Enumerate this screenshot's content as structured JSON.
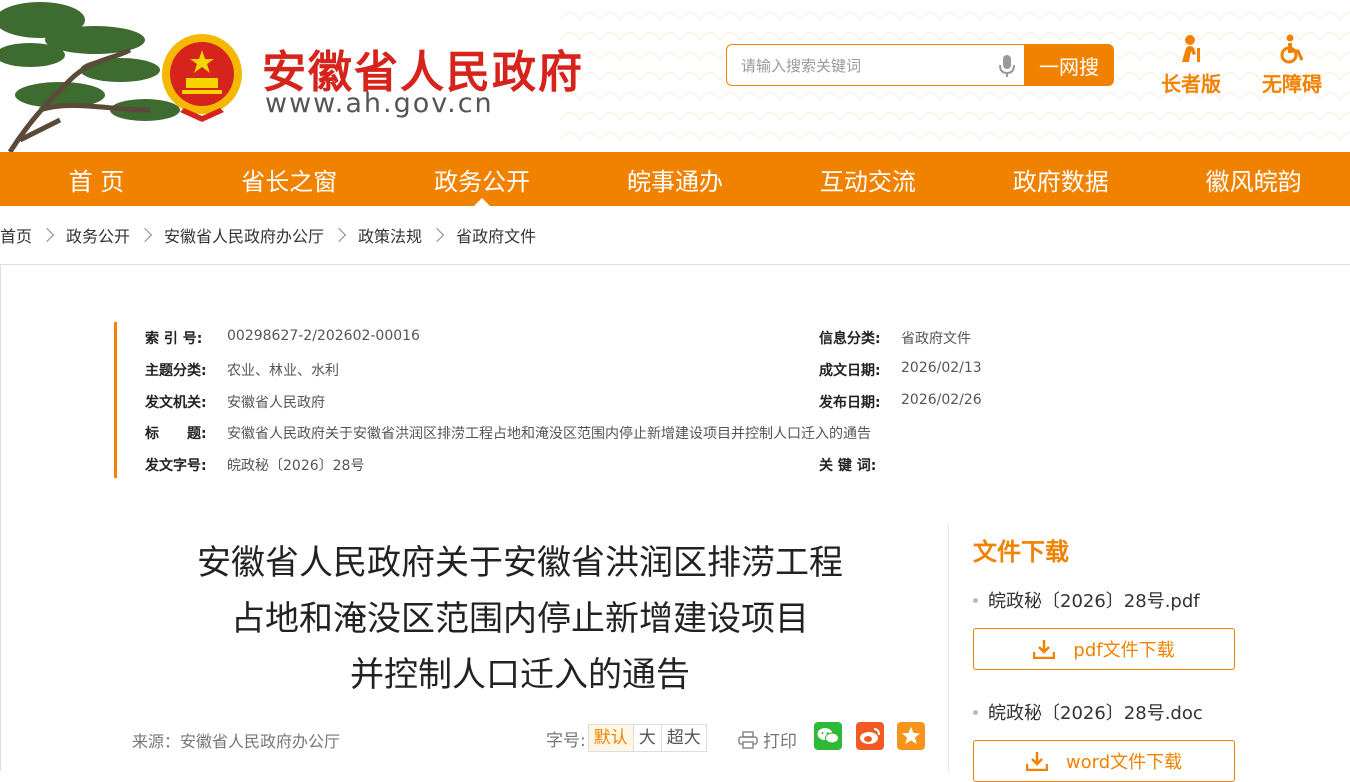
{
  "header": {
    "site_name": "安徽省人民政府",
    "site_url": "www.ah.gov.cn",
    "search": {
      "placeholder": "请输入搜索关键词",
      "button": "一网搜"
    },
    "tools": [
      {
        "label": "长者版",
        "icon": "elder-icon"
      },
      {
        "label": "无障碍",
        "icon": "wheelchair-icon"
      }
    ]
  },
  "nav": [
    "首 页",
    "省长之窗",
    "政务公开",
    "皖事通办",
    "互动交流",
    "政府数据",
    "徽风皖韵"
  ],
  "nav_active": "政务公开",
  "breadcrumb": [
    "首页",
    "政务公开",
    "安徽省人民政府办公厅",
    "政策法规",
    "省政府文件"
  ],
  "meta": {
    "index_label": "索 引 号:",
    "index": "00298627-2/202602-00016",
    "category_label": "信息分类:",
    "category": "省政府文件",
    "topic_label": "主题分类:",
    "topic": "农业、林业、水利",
    "created_label": "成文日期:",
    "created": "2026/02/13",
    "issuer_label": "发文机关:",
    "issuer": "安徽省人民政府",
    "published_label": "发布日期:",
    "published": "2026/02/26",
    "title_label": "标　　题:",
    "title": "安徽省人民政府关于安徽省洪润区排涝工程占地和淹没区范围内停止新增建设项目并控制人口迁入的通告",
    "docno_label": "发文字号:",
    "docno": "皖政秘〔2026〕28号",
    "keywords_label": "关 键 词:",
    "keywords": ""
  },
  "article": {
    "title_lines": [
      "安徽省人民政府关于安徽省洪润区排涝工程",
      "占地和淹没区范围内停止新增建设项目",
      "并控制人口迁入的通告"
    ],
    "source": "来源：安徽省人民政府办公厅",
    "font_label": "字号:",
    "font_sizes": [
      "默认",
      "大",
      "超大"
    ],
    "print": "打印",
    "share": [
      {
        "icon": "wechat-icon",
        "color": "#2dbb37"
      },
      {
        "icon": "weibo-icon",
        "color": "#f15a23"
      },
      {
        "icon": "favorite-icon",
        "color": "#f7941d"
      }
    ]
  },
  "downloads": {
    "title": "文件下载",
    "files": [
      {
        "name": "皖政秘〔2026〕28号.pdf",
        "button": "pdf文件下载"
      },
      {
        "name": "皖政秘〔2026〕28号.doc",
        "button": "word文件下载"
      }
    ]
  },
  "colors": {
    "accent": "#f08200",
    "brand_red": "#d6231c"
  }
}
